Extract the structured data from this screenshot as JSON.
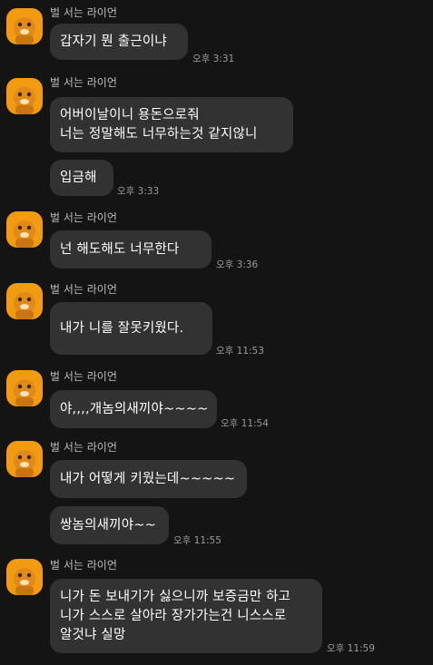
{
  "sender_name": "벌 서는 라이언",
  "groups": [
    {
      "messages": [
        {
          "lines": [
            "갑자기 뭔 출근이냐"
          ],
          "time": "오후 3:31"
        }
      ]
    },
    {
      "messages": [
        {
          "lines": [
            "어버이날이니  용돈으로줘",
            "너는  정말해도 너무하는것  같지않니"
          ],
          "time": ""
        },
        {
          "lines": [
            "입금해"
          ],
          "time": "오후 3:33"
        }
      ]
    },
    {
      "messages": [
        {
          "lines": [
            "넌  해도해도  너무한다"
          ],
          "time": "오후 3:36"
        }
      ]
    },
    {
      "messages": [
        {
          "lines": [
            "내가  니를 잘못키웠다."
          ],
          "time": "오후 11:53"
        }
      ]
    },
    {
      "messages": [
        {
          "lines": [
            "야,,,,개놈의새끼야~~~~"
          ],
          "time": "오후 11:54"
        }
      ]
    },
    {
      "messages": [
        {
          "lines": [
            "내가  어떻게 키웠는데~~~~~"
          ],
          "time": ""
        },
        {
          "lines": [
            "쌍놈의새끼야~~"
          ],
          "time": "오후 11:55"
        }
      ]
    },
    {
      "messages": [
        {
          "lines": [
            "니가 돈 보내기가 싫으니까 보증금만 하고",
            "니가 스스로 살아라 장가가는건 니스스로",
            "알것냐  실망"
          ],
          "time": "오후 11:59"
        }
      ]
    }
  ]
}
